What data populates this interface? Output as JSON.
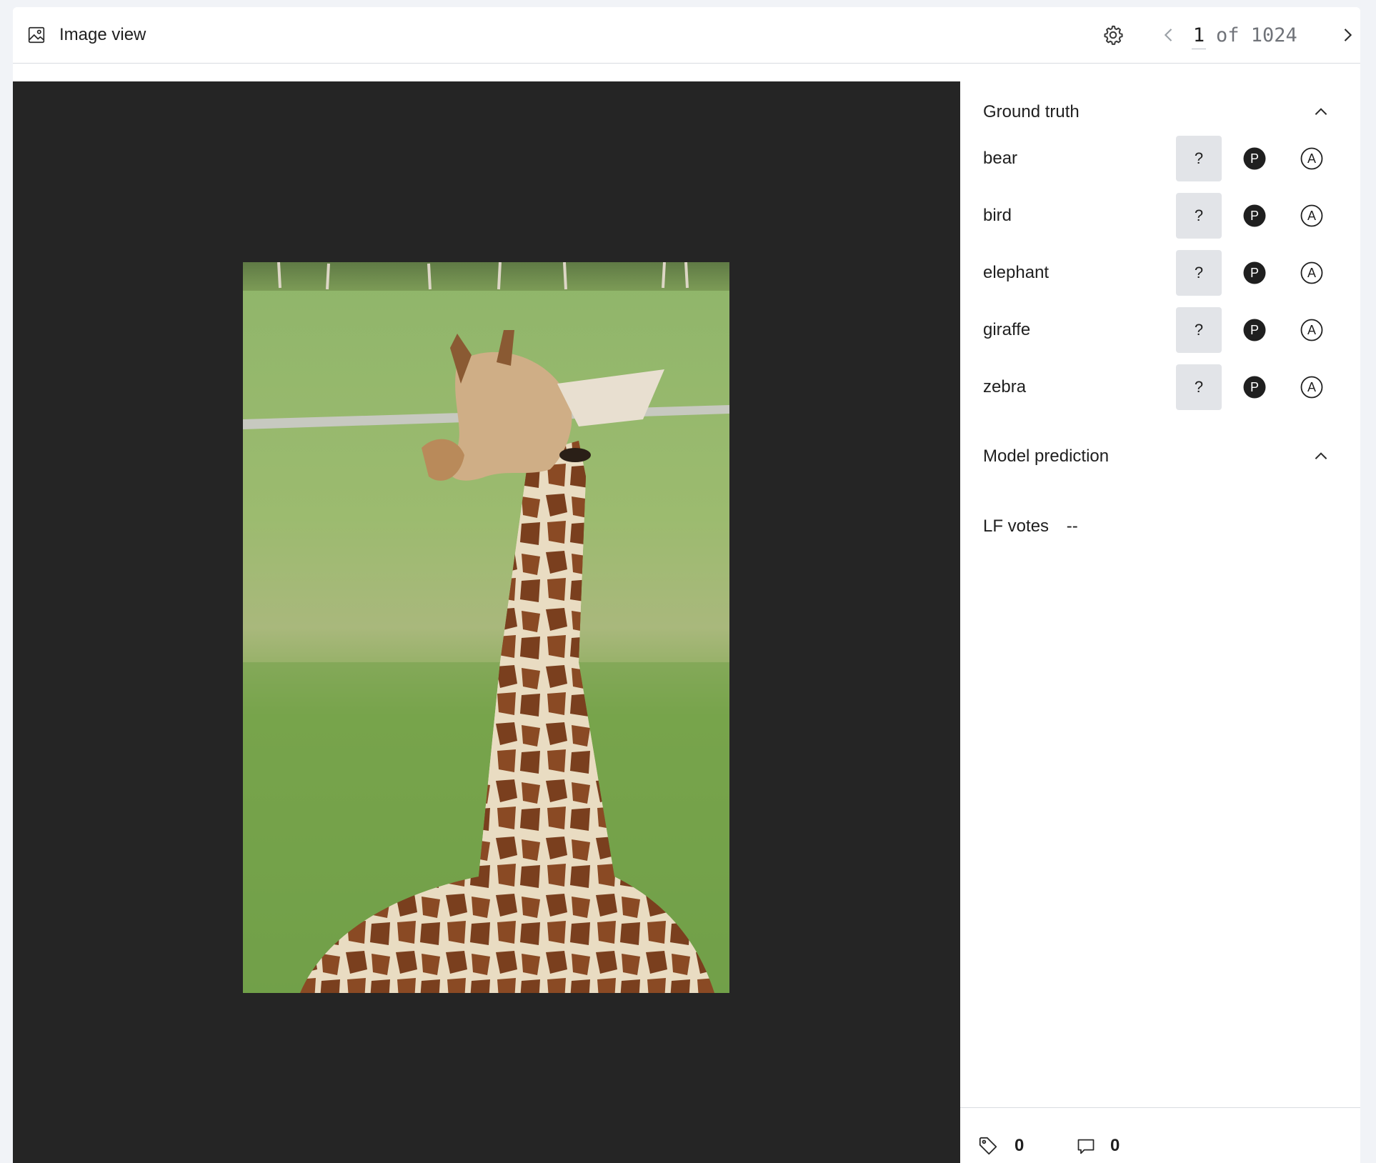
{
  "header": {
    "title": "Image view",
    "title_icon": "image-icon",
    "settings_icon": "gear-icon",
    "pager": {
      "current": "1",
      "of_text": "of 1024"
    }
  },
  "viewer": {
    "background": "#252525",
    "image_subject": "giraffe-photo"
  },
  "ground_truth": {
    "title": "Ground truth",
    "labels": [
      {
        "name": "bear",
        "unknown": "?"
      },
      {
        "name": "bird",
        "unknown": "?"
      },
      {
        "name": "elephant",
        "unknown": "?"
      },
      {
        "name": "giraffe",
        "unknown": "?"
      },
      {
        "name": "zebra",
        "unknown": "?"
      }
    ]
  },
  "model_prediction": {
    "title": "Model prediction"
  },
  "lf_votes": {
    "label": "LF votes",
    "value": "--"
  },
  "footer": {
    "tag_count": "0",
    "comment_count": "0"
  },
  "colors": {
    "page_bg": "#f1f3f7",
    "unknown_button_bg": "#e2e4e8",
    "text": "#1f1f1f",
    "pager_muted": "#707379"
  }
}
